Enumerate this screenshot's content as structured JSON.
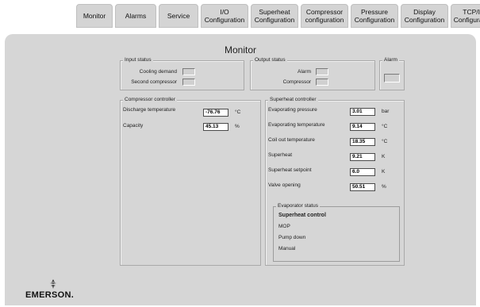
{
  "nav": {
    "tabs": [
      {
        "label": "Monitor"
      },
      {
        "label": "Alarms"
      },
      {
        "label": "Service"
      },
      {
        "label": "I/O\nConfiguration"
      },
      {
        "label": "Superheat\nConfiguration"
      },
      {
        "label": "Compressor\nconfiguration"
      },
      {
        "label": "Pressure\nConfiguration"
      },
      {
        "label": "Display\nConfiguration"
      },
      {
        "label": "TCP/IP\nConfiguration"
      }
    ]
  },
  "page": {
    "title": "Monitor"
  },
  "input_status": {
    "legend": "Input status",
    "cooling_demand": "Cooling demand",
    "second_compressor": "Second compressor"
  },
  "output_status": {
    "legend": "Output status",
    "alarm": "Alarm",
    "compressor": "Compressor"
  },
  "alarm_box": {
    "legend": "Alarm"
  },
  "compressor_controller": {
    "legend": "Compressor controller",
    "rows": [
      {
        "label": "Discharge temperature",
        "value": "-76.76",
        "unit": "°C"
      },
      {
        "label": "Capacity",
        "value": "45.13",
        "unit": "%"
      }
    ]
  },
  "superheat_controller": {
    "legend": "Superheat controller",
    "rows": [
      {
        "label": "Evaporating pressure",
        "value": "3.01",
        "unit": "bar"
      },
      {
        "label": "Evaporating temperature",
        "value": "9.14",
        "unit": "°C"
      },
      {
        "label": "Coil out temperature",
        "value": "18.35",
        "unit": "°C"
      },
      {
        "label": "Superheat",
        "value": "9.21",
        "unit": "K"
      },
      {
        "label": "Superheat setpoint",
        "value": "6.0",
        "unit": "K"
      },
      {
        "label": "Valve opening",
        "value": "50.51",
        "unit": "%"
      }
    ]
  },
  "evaporator_status": {
    "legend": "Evaporator status",
    "items": [
      "Superheat control",
      "MOP",
      "Pump down",
      "Manual"
    ]
  },
  "brand": {
    "name": "EMERSON."
  }
}
